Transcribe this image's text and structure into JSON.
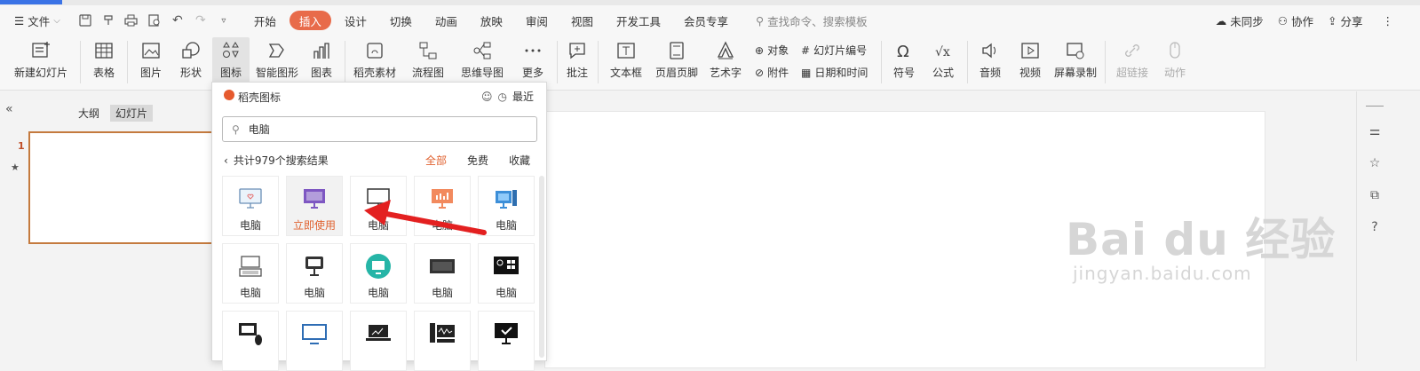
{
  "menu": {
    "file_label": "文件",
    "tabs": [
      "开始",
      "插入",
      "设计",
      "切换",
      "动画",
      "放映",
      "审阅",
      "视图",
      "开发工具",
      "会员专享"
    ],
    "active_tab": "插入",
    "search_placeholder": "查找命令、搜索模板",
    "sync": "未同步",
    "collab": "协作",
    "share": "分享"
  },
  "ribbon": {
    "new_slide": "新建幻灯片",
    "table": "表格",
    "picture": "图片",
    "shape": "形状",
    "icon": "图标",
    "smart_art": "智能图形",
    "chart": "图表",
    "daoke_material": "稻壳素材",
    "flowchart": "流程图",
    "mindmap": "思维导图",
    "more": "更多",
    "comment": "批注",
    "textbox": "文本框",
    "header_footer": "页眉页脚",
    "wordart": "艺术字",
    "object": "对象",
    "slide_number": "幻灯片编号",
    "attachment": "附件",
    "datetime": "日期和时间",
    "symbol": "符号",
    "formula": "公式",
    "audio": "音频",
    "video": "视频",
    "screen_record": "屏幕录制",
    "hyperlink": "超链接",
    "action": "动作"
  },
  "left_panel": {
    "tab_outline": "大纲",
    "tab_slides": "幻灯片",
    "slide_number": "1"
  },
  "icon_panel": {
    "title": "稻壳图标",
    "recent": "最近",
    "search_value": "电脑",
    "result_text": "共计979个搜索结果",
    "filters": [
      "全部",
      "免费",
      "收藏"
    ],
    "active_filter": "全部",
    "items": [
      {
        "label": "电脑",
        "icon": "monitor-heart-icon"
      },
      {
        "label": "立即使用",
        "icon": "monitor-purple-icon"
      },
      {
        "label": "电脑",
        "icon": "monitor-outline-icon"
      },
      {
        "label": "电脑",
        "icon": "monitor-chart-icon"
      },
      {
        "label": "电脑",
        "icon": "monitor-blue-icon"
      },
      {
        "label": "电脑",
        "icon": "laptop-keyboard-icon"
      },
      {
        "label": "电脑",
        "icon": "monitor-dark-icon"
      },
      {
        "label": "电脑",
        "icon": "monitor-teal-icon"
      },
      {
        "label": "电脑",
        "icon": "monitor-black-icon"
      },
      {
        "label": "电脑",
        "icon": "monitor-grid-icon"
      },
      {
        "label": "",
        "icon": "monitor-mouse-icon"
      },
      {
        "label": "",
        "icon": "monitor-blue-outline-icon"
      },
      {
        "label": "",
        "icon": "laptop-chart-icon"
      },
      {
        "label": "",
        "icon": "monitor-wave-icon"
      },
      {
        "label": "",
        "icon": "monitor-check-icon"
      }
    ]
  },
  "watermark": {
    "main": "Bai du 经验",
    "sub": "jingyan.baidu.com"
  },
  "colors": {
    "accent": "#e86b4a",
    "filter_active": "#e0612f",
    "thumb_border": "#c47a3e"
  }
}
